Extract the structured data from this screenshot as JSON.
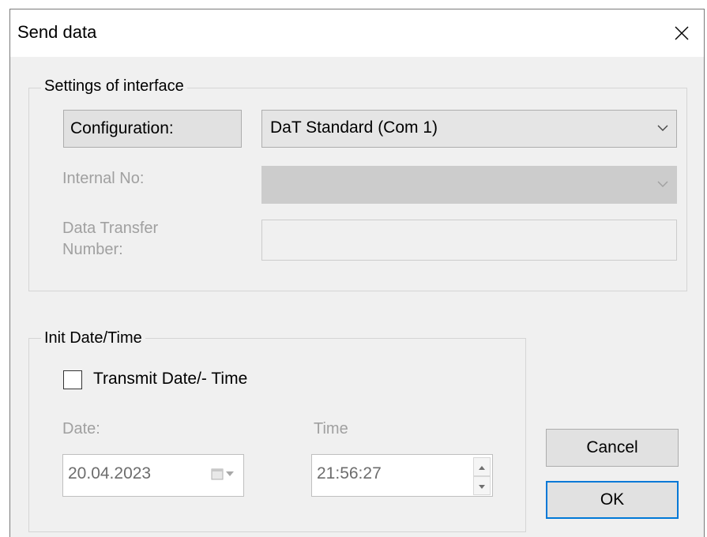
{
  "dialog": {
    "title": "Send data",
    "close_glyph": "close-icon"
  },
  "interface_group": {
    "title": "Settings of interface",
    "configuration_label": "Configuration:",
    "configuration_value": "DaT Standard (Com 1)",
    "internal_no_label": "Internal No:",
    "internal_no_value": "",
    "transfer_label_line1": "Data Transfer",
    "transfer_label_line2": "Number:",
    "transfer_value": ""
  },
  "datetime_group": {
    "title": "Init Date/Time",
    "transmit_label": "Transmit Date/- Time",
    "transmit_checked": false,
    "date_label": "Date:",
    "date_value": "20.04.2023",
    "time_label": "Time",
    "time_value": "21:56:27"
  },
  "buttons": {
    "cancel_label": "Cancel",
    "ok_label": "OK"
  },
  "colors": {
    "dialog_bg": "#f0f0f0",
    "accent": "#0078d7",
    "disabled_text": "#a0a0a0"
  }
}
